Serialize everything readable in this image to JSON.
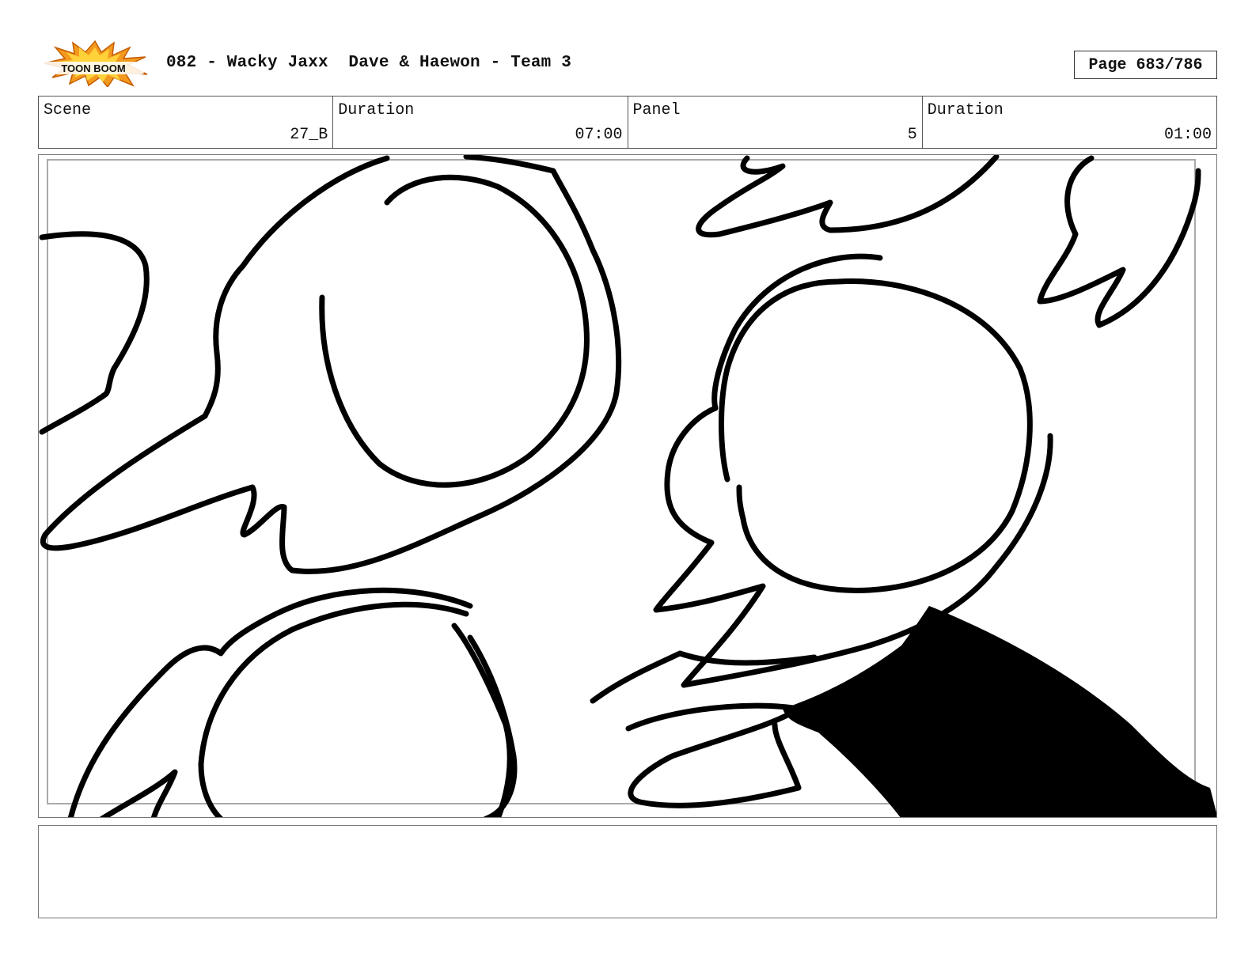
{
  "header": {
    "logo_text": "TOON BOOM",
    "title": "082 - Wacky Jaxx  Dave & Haewon - Team 3",
    "page_label": "Page 683/786"
  },
  "info": {
    "scene_label": "Scene",
    "scene_value": "27_B",
    "scene_duration_label": "Duration",
    "scene_duration_value": "07:00",
    "panel_label": "Panel",
    "panel_value": "5",
    "panel_duration_label": "Duration",
    "panel_duration_value": "01:00"
  },
  "notes": {
    "text": ""
  }
}
